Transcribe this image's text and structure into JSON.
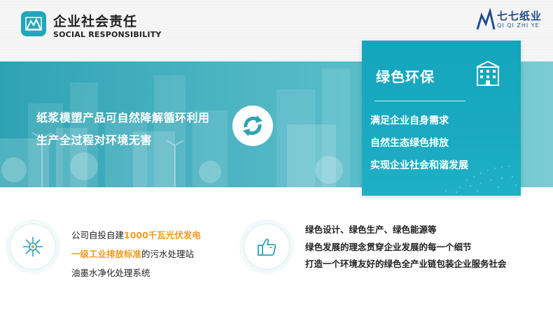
{
  "header": {
    "title": "企业社会责任",
    "subtitle": "SOCIAL RESPONSIBILITY",
    "logo_text": "七七纸业",
    "logo_sub": "QI QI ZHI YE",
    "accent": "#21a7bb"
  },
  "banner": {
    "line1": "纸浆模塑产品可自然降解循环利用",
    "line2": "生产全过程对环境无害"
  },
  "green_card": {
    "title": "绿色环保",
    "items": [
      "满足企业自身需求",
      "自然生态绿色排放",
      "实现企业社会和谐发展"
    ]
  },
  "left_block": {
    "line1_prefix": "公司自投自建",
    "line1_highlight": "1000千瓦光伏发电",
    "line2_highlight": "一级工业排放标准",
    "line2_suffix": "的污水处理站",
    "line3": "油墨水净化处理系统",
    "highlight_color": "#f39a1e"
  },
  "right_block": {
    "lines": [
      "绿色设计、绿色生产、绿色能源等",
      "绿色发展的理念贯穿企业发展的每一个细节",
      "打造一个环境友好的绿色全产业链包装企业服务社会"
    ]
  },
  "icons": {
    "title": "leaf-logo-icon",
    "recycle": "recycle-icon",
    "building": "building-icon",
    "energy": "energy-network-icon",
    "thumb": "thumbs-up-icon"
  }
}
